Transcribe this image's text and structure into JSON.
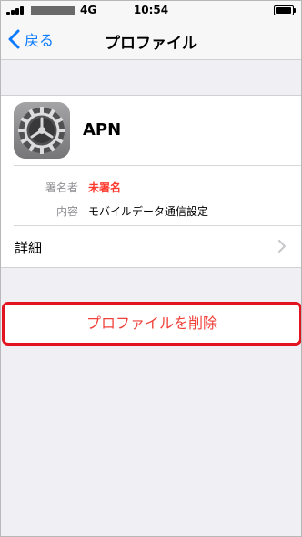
{
  "status_bar": {
    "network": "4G",
    "time": "10:54"
  },
  "nav": {
    "back_label": "戻る",
    "title": "プロファイル"
  },
  "profile": {
    "name": "APN",
    "signer_label": "署名者",
    "signer_value": "未署名",
    "contents_label": "内容",
    "contents_value": "モバイルデータ通信設定",
    "details_label": "詳細"
  },
  "actions": {
    "remove_label": "プロファイルを削除"
  },
  "icons": {
    "back": "chevron-left-icon",
    "settings": "settings-gear-icon",
    "details": "chevron-right-icon"
  },
  "colors": {
    "accent_blue": "#0a7aff",
    "destructive_red": "#ff3b30",
    "highlight_red": "#e2141f"
  }
}
